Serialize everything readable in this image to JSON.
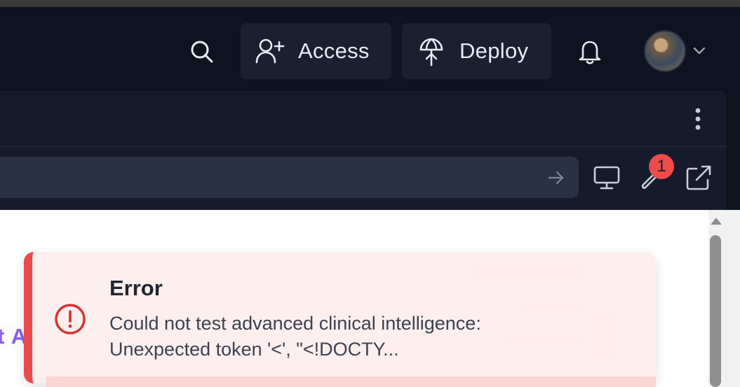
{
  "header": {
    "access_label": "Access",
    "deploy_label": "Deploy",
    "icons": [
      "search-icon",
      "add-user-icon",
      "deploy-icon",
      "bell-icon",
      "chevron-down-icon"
    ]
  },
  "toolbar": {
    "issues_badge": "1",
    "icons": [
      "kebab-menu-icon",
      "arrow-right-icon",
      "monitor-icon",
      "wrench-icon",
      "external-link-icon"
    ]
  },
  "preview": {
    "partial_heading": "t A"
  },
  "toast": {
    "title": "Error",
    "message_line1": "Could not test advanced clinical intelligence:",
    "message_line2": "Unexpected token '<', \"<!DOCTY...",
    "icon": "alert-circle-icon"
  },
  "colors": {
    "background": "#0e1320",
    "panel": "#151b2b",
    "button": "#1a2030",
    "url_bar": "#2a3144",
    "badge": "#ef4b4b",
    "error_accent": "#ea4a4a",
    "toast_bg": "#fceeec",
    "brand_purple": "#8b5cf6"
  }
}
